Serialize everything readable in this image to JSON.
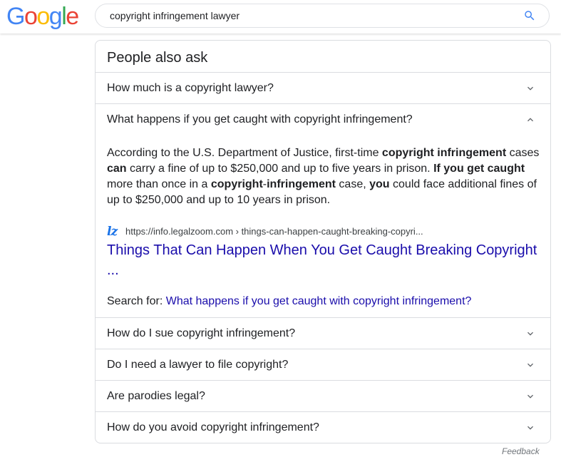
{
  "header": {
    "logo": [
      "G",
      "o",
      "o",
      "g",
      "l",
      "e"
    ],
    "logo_colors": [
      "#4285F4",
      "#EA4335",
      "#FBBC05",
      "#4285F4",
      "#34A853",
      "#EA4335"
    ],
    "search_value": "copyright infringement lawyer",
    "search_icon": "search-icon",
    "accent": "#4285F4"
  },
  "paa": {
    "title": "People also ask",
    "questions": [
      {
        "text": "How much is a copyright lawyer?",
        "expanded": false
      },
      {
        "text": "What happens if you get caught with copyright infringement?",
        "expanded": true
      },
      {
        "text": "How do I sue copyright infringement?",
        "expanded": false
      },
      {
        "text": "Do I need a lawyer to file copyright?",
        "expanded": false
      },
      {
        "text": "Are parodies legal?",
        "expanded": false
      },
      {
        "text": "How do you avoid copyright infringement?",
        "expanded": false
      }
    ],
    "answer": {
      "segments": [
        {
          "text": "According to the U.S. Department of Justice, first-time ",
          "bold": false
        },
        {
          "text": "copyright infringement",
          "bold": true
        },
        {
          "text": " cases ",
          "bold": false
        },
        {
          "text": "can",
          "bold": true
        },
        {
          "text": " carry a fine of up to $250,000 and up to five years in prison. ",
          "bold": false
        },
        {
          "text": "If you get caught",
          "bold": true
        },
        {
          "text": " more than once in a ",
          "bold": false
        },
        {
          "text": "copyright",
          "bold": true
        },
        {
          "text": "-",
          "bold": false
        },
        {
          "text": "infringement",
          "bold": true
        },
        {
          "text": " case, ",
          "bold": false
        },
        {
          "text": "you",
          "bold": true
        },
        {
          "text": " could face additional fines of up to $250,000 and up to 10 years in prison.",
          "bold": false
        }
      ],
      "source_favicon": "lz",
      "source_url": "https://info.legalzoom.com › things-can-happen-caught-breaking-copyri...",
      "result_title": "Things That Can Happen When You Get Caught Breaking Copyright ...",
      "search_for_label": "Search for:",
      "search_for_link": "What happens if you get caught with copyright infringement?"
    },
    "link_color": "#1a0dab"
  },
  "feedback": "Feedback"
}
